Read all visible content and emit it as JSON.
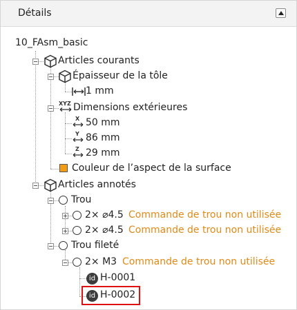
{
  "header": {
    "title": "Détails"
  },
  "tree": {
    "root": "10_FAsm_basic",
    "articles_courants": "Articles courants",
    "epaisseur": "Épaisseur de la tôle",
    "epaisseur_value": "1 mm",
    "dimensions": "Dimensions extérieures",
    "dim_x": "50 mm",
    "dim_y": "86 mm",
    "dim_z": "29 mm",
    "couleur": "Couleur de l’aspect de la surface",
    "articles_annotes": "Articles annotés",
    "trou": "Trou",
    "trou_item1": "2× ⌀4.5",
    "trou_item2": "2× ⌀4.5",
    "trou_filete": "Trou fileté",
    "trou_filete_item": "2× M3",
    "commande_non_utilisee": "Commande de trou non utilisée",
    "id_badge": "id",
    "id_1": "H-0001",
    "id_2": "H-0002"
  },
  "colors": {
    "surface": "#f39c12",
    "orange_text": "#e08a17",
    "highlight": "#e01010"
  },
  "icons": {
    "collapse": "triangle-up-icon",
    "part": "cube-icon",
    "thickness": "thickness-icon",
    "dimensions": "xyz-arrow-icon",
    "hole": "circle-icon",
    "id": "id-badge-icon"
  }
}
